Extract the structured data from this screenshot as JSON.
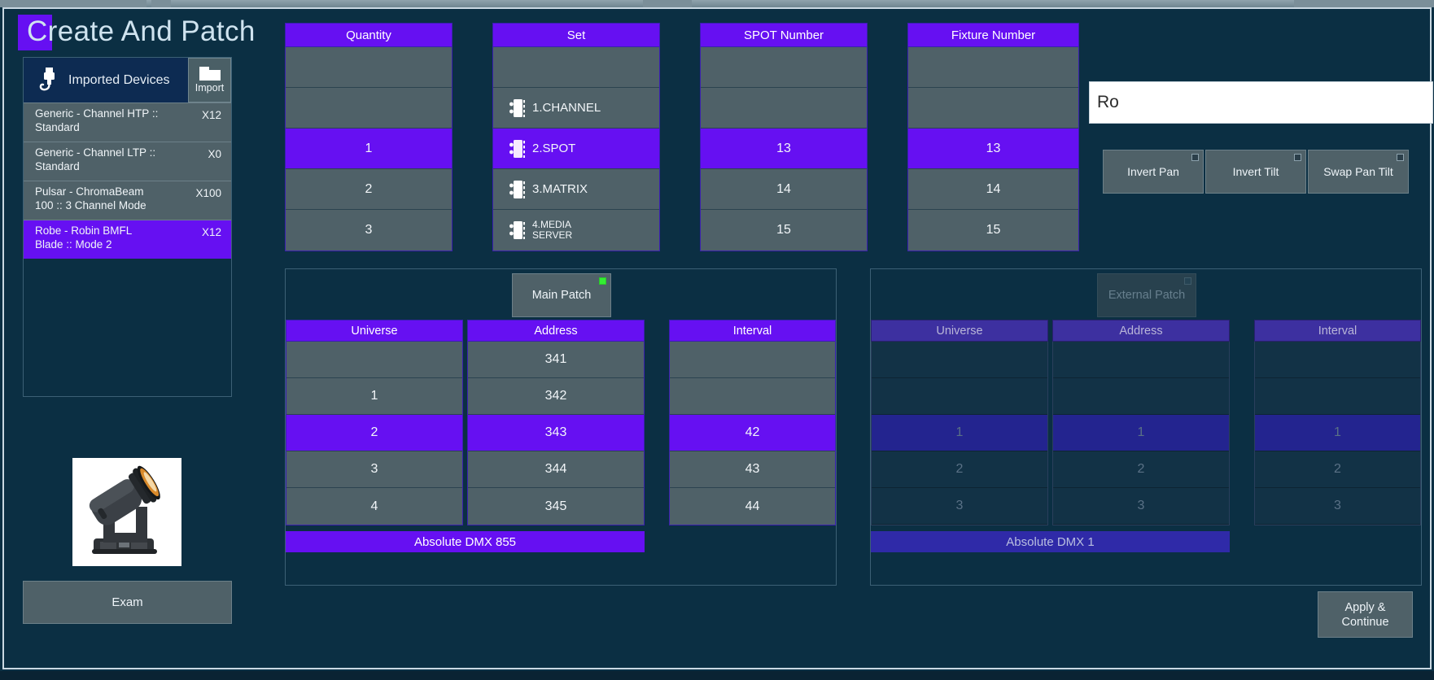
{
  "window": {
    "title_bar_visible": true
  },
  "page": {
    "title": "Create And Patch"
  },
  "devices_panel": {
    "header_label": "Imported Devices",
    "plug_icon": "plug-icon",
    "import_button": {
      "label": "Import",
      "icon": "folder-icon"
    },
    "rows": [
      {
        "name": "Generic - Channel HTP ::\nStandard",
        "count": "X12",
        "selected": false
      },
      {
        "name": "Generic - Channel LTP ::\nStandard",
        "count": "X0",
        "selected": false
      },
      {
        "name": "Pulsar - ChromaBeam\n100 :: 3 Channel Mode",
        "count": "X100",
        "selected": false
      },
      {
        "name": "Robe - Robin BMFL\nBlade :: Mode 2",
        "count": "X12",
        "selected": true
      }
    ]
  },
  "fixture_preview": {
    "icon": "moving-head-fixture-image"
  },
  "exam_button": {
    "label": "Exam"
  },
  "selectors": {
    "quantity": {
      "header": "Quantity",
      "items": [
        {
          "label": "",
          "selected": false
        },
        {
          "label": "",
          "selected": false
        },
        {
          "label": "1",
          "selected": true
        },
        {
          "label": "2",
          "selected": false
        },
        {
          "label": "3",
          "selected": false
        }
      ]
    },
    "set": {
      "header": "Set",
      "items": [
        {
          "label": "",
          "selected": false,
          "icon": ""
        },
        {
          "label": "1.CHANNEL",
          "selected": false,
          "icon": "page-icon"
        },
        {
          "label": "2.SPOT",
          "selected": true,
          "icon": "page-icon"
        },
        {
          "label": "3.MATRIX",
          "selected": false,
          "icon": "page-icon"
        },
        {
          "label": "4.MEDIA\nSERVER",
          "selected": false,
          "icon": "page-icon"
        }
      ]
    },
    "spot_number": {
      "header": "SPOT Number",
      "items": [
        {
          "label": "",
          "selected": false
        },
        {
          "label": "",
          "selected": false
        },
        {
          "label": "13",
          "selected": true
        },
        {
          "label": "14",
          "selected": false
        },
        {
          "label": "15",
          "selected": false
        }
      ]
    },
    "fixture_number": {
      "header": "Fixture Number",
      "items": [
        {
          "label": "",
          "selected": false
        },
        {
          "label": "",
          "selected": false
        },
        {
          "label": "13",
          "selected": true
        },
        {
          "label": "14",
          "selected": false
        },
        {
          "label": "15",
          "selected": false
        }
      ]
    }
  },
  "name_field": {
    "value": "Ro"
  },
  "toggles": [
    {
      "label": "Invert Pan",
      "on": false
    },
    {
      "label": "Invert Tilt",
      "on": false
    },
    {
      "label": "Swap Pan Tilt",
      "on": false
    }
  ],
  "main_patch": {
    "tab_label": "Main Patch",
    "tab_active": true,
    "universe": {
      "header": "Universe",
      "items": [
        {
          "label": "",
          "selected": false
        },
        {
          "label": "1",
          "selected": false
        },
        {
          "label": "2",
          "selected": true
        },
        {
          "label": "3",
          "selected": false
        },
        {
          "label": "4",
          "selected": false
        }
      ]
    },
    "address": {
      "header": "Address",
      "items": [
        {
          "label": "341",
          "selected": false
        },
        {
          "label": "342",
          "selected": false
        },
        {
          "label": "343",
          "selected": true
        },
        {
          "label": "344",
          "selected": false
        },
        {
          "label": "345",
          "selected": false
        }
      ]
    },
    "interval": {
      "header": "Interval",
      "items": [
        {
          "label": "",
          "selected": false
        },
        {
          "label": "",
          "selected": false
        },
        {
          "label": "42",
          "selected": true
        },
        {
          "label": "43",
          "selected": false
        },
        {
          "label": "44",
          "selected": false
        }
      ]
    },
    "absolute_dmx": "Absolute DMX 855"
  },
  "external_patch": {
    "tab_label": "External Patch",
    "tab_active": false,
    "universe": {
      "header": "Universe",
      "items": [
        {
          "label": "",
          "selected": false
        },
        {
          "label": "",
          "selected": false
        },
        {
          "label": "1",
          "selected": true
        },
        {
          "label": "2",
          "selected": false
        },
        {
          "label": "3",
          "selected": false
        }
      ]
    },
    "address": {
      "header": "Address",
      "items": [
        {
          "label": "",
          "selected": false
        },
        {
          "label": "",
          "selected": false
        },
        {
          "label": "1",
          "selected": true
        },
        {
          "label": "2",
          "selected": false
        },
        {
          "label": "3",
          "selected": false
        }
      ]
    },
    "interval": {
      "header": "Interval",
      "items": [
        {
          "label": "",
          "selected": false
        },
        {
          "label": "",
          "selected": false
        },
        {
          "label": "1",
          "selected": true
        },
        {
          "label": "2",
          "selected": false
        },
        {
          "label": "3",
          "selected": false
        }
      ]
    },
    "absolute_dmx": "Absolute DMX 1"
  },
  "apply_button": {
    "label": "Apply &\nContinue"
  },
  "colors": {
    "background": "#0b2f43",
    "accent_purple": "#6610f2",
    "cell_gray": "#4f6168",
    "panel_border": "#3c6075",
    "led_on": "#33ee33"
  }
}
